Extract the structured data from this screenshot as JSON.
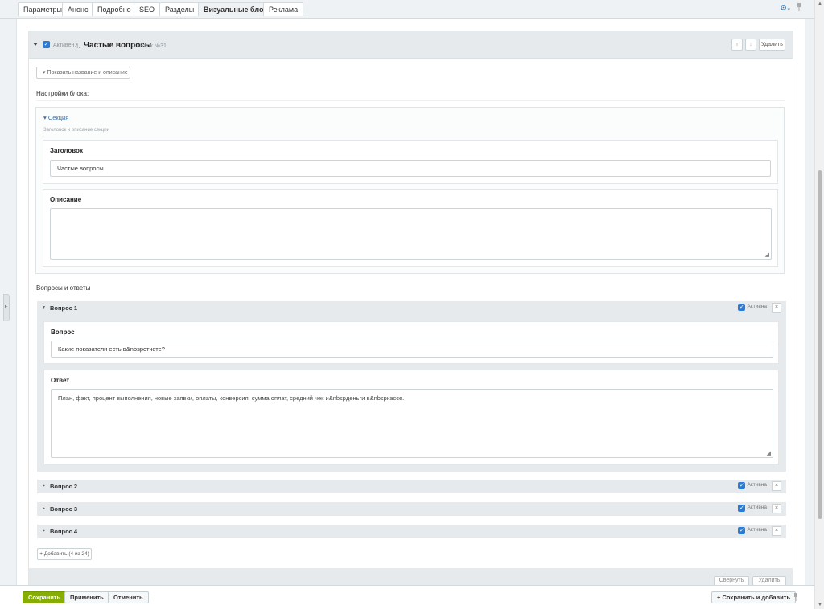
{
  "tabs": [
    {
      "label": "Параметры"
    },
    {
      "label": "Анонс"
    },
    {
      "label": "Подробно"
    },
    {
      "label": "SEO"
    },
    {
      "label": "Разделы"
    },
    {
      "label": "Визуальные блоки",
      "active": true
    },
    {
      "label": "Реклама"
    }
  ],
  "icons": {
    "settings": "gear-icon",
    "pin": "pin-icon",
    "check": "✓",
    "caret": "▸",
    "close": "×",
    "up": "↑",
    "down": "↓",
    "plus": "+"
  },
  "block": {
    "active_label": "Активен",
    "index": "4.",
    "title": "Частые вопросы",
    "number": "Блок №31",
    "up": "↑",
    "down": "↓",
    "delete_label": "Удалить",
    "show_name_desc": "▾ Показать название и описание",
    "settings_heading": "Настройки блока:"
  },
  "section": {
    "title": "▾ Секция",
    "hint": "Заголовок и описание секции",
    "heading_label": "Заголовок",
    "heading_value": "Частые вопросы",
    "description_label": "Описание",
    "description_value": ""
  },
  "qa": {
    "heading": "Вопросы и ответы",
    "items": [
      {
        "title": "Вопрос 1",
        "active_label": "Активна",
        "question_label": "Вопрос",
        "question_value": "Какие показатели есть в&nbspотчете?",
        "answer_label": "Ответ",
        "answer_value": "План, факт, процент выполнения, новые заявки, оплаты, конверсия, сумма оплат, средний чек и&nbspденьги в&nbspкассе."
      },
      {
        "title": "Вопрос 2",
        "active_label": "Активна"
      },
      {
        "title": "Вопрос 3",
        "active_label": "Активна"
      },
      {
        "title": "Вопрос 4",
        "active_label": "Активна"
      }
    ],
    "add_label": "+ Добавить (4 из 24)"
  },
  "block_footer": {
    "collapse_label": "Свернуть",
    "delete_label": "Удалить"
  },
  "bottom": {
    "save": "Сохранить",
    "apply": "Применить",
    "cancel": "Отменить",
    "save_add": "+ Сохранить и добавить"
  },
  "colors": {
    "accent": "#2a7bd4",
    "save": "#86ad00"
  }
}
